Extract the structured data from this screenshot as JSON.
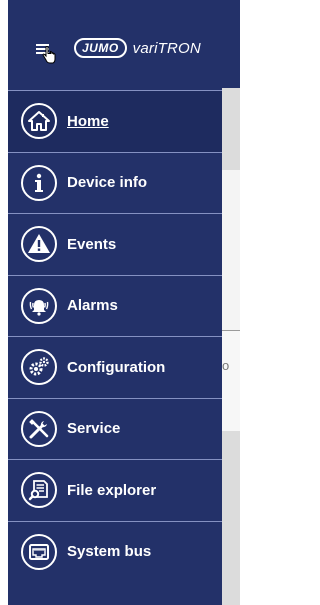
{
  "header": {
    "brand_badge": "JUMO",
    "product_name": "variTRON"
  },
  "background": {
    "fragment_text": "o"
  },
  "nav": {
    "items": [
      {
        "label": "Home",
        "icon": "home-icon",
        "active": true
      },
      {
        "label": "Device info",
        "icon": "info-icon",
        "active": false
      },
      {
        "label": "Events",
        "icon": "warning-icon",
        "active": false
      },
      {
        "label": "Alarms",
        "icon": "alarm-bell-icon",
        "active": false
      },
      {
        "label": "Configuration",
        "icon": "gears-icon",
        "active": false
      },
      {
        "label": "Service",
        "icon": "tools-icon",
        "active": false
      },
      {
        "label": "File explorer",
        "icon": "file-search-icon",
        "active": false
      },
      {
        "label": "System bus",
        "icon": "network-port-icon",
        "active": false
      }
    ]
  },
  "colors": {
    "drawer_bg": "#233169",
    "active_item_bg": "#1e2b5f",
    "divider": "#8591c2",
    "text": "#ffffff"
  }
}
